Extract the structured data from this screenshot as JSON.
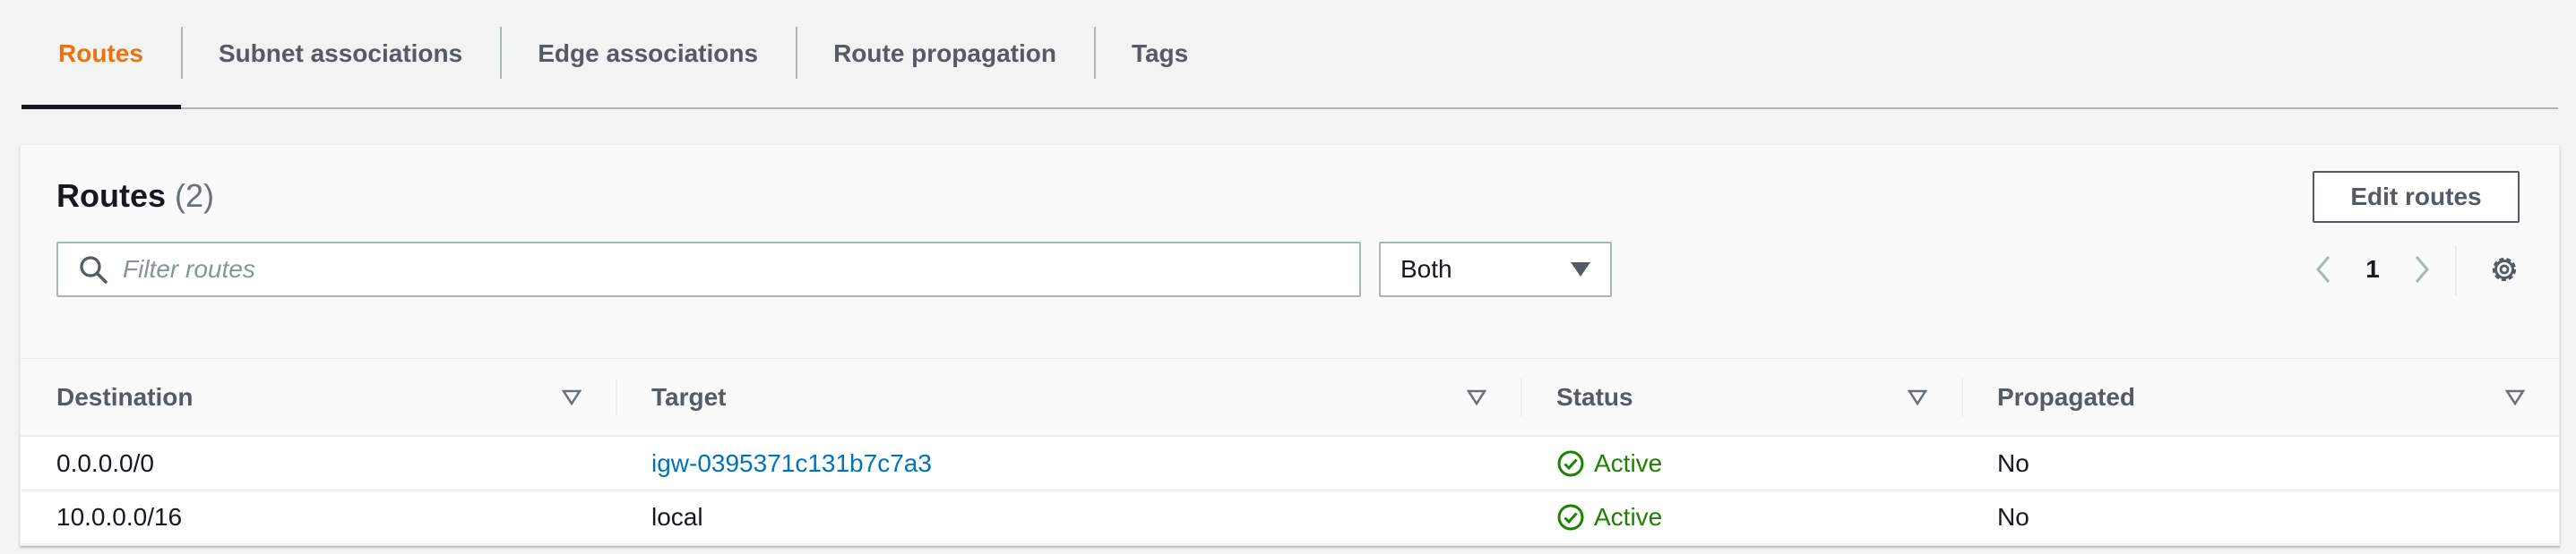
{
  "tabs": [
    {
      "label": "Routes",
      "active": true
    },
    {
      "label": "Subnet associations",
      "active": false
    },
    {
      "label": "Edge associations",
      "active": false
    },
    {
      "label": "Route propagation",
      "active": false
    },
    {
      "label": "Tags",
      "active": false
    }
  ],
  "panel": {
    "title": "Routes",
    "count": "(2)",
    "edit_button": "Edit routes",
    "filter_placeholder": "Filter routes",
    "select_value": "Both",
    "page_number": "1"
  },
  "table": {
    "columns": [
      "Destination",
      "Target",
      "Status",
      "Propagated"
    ],
    "rows": [
      {
        "destination": "0.0.0.0/0",
        "target": "igw-0395371c131b7c7a3",
        "target_is_link": true,
        "status": "Active",
        "propagated": "No"
      },
      {
        "destination": "10.0.0.0/16",
        "target": "local",
        "target_is_link": false,
        "status": "Active",
        "propagated": "No"
      }
    ]
  },
  "icons": {
    "search": "search-icon",
    "dropdown": "caret-down-icon",
    "prev": "chevron-left-icon",
    "next": "chevron-right-icon",
    "settings": "gear-icon",
    "sort": "sort-triangle-icon",
    "status": "check-circle-icon"
  },
  "colors": {
    "accent_tab": "#ec7211",
    "link": "#0073bb",
    "status_success": "#1d8102"
  }
}
